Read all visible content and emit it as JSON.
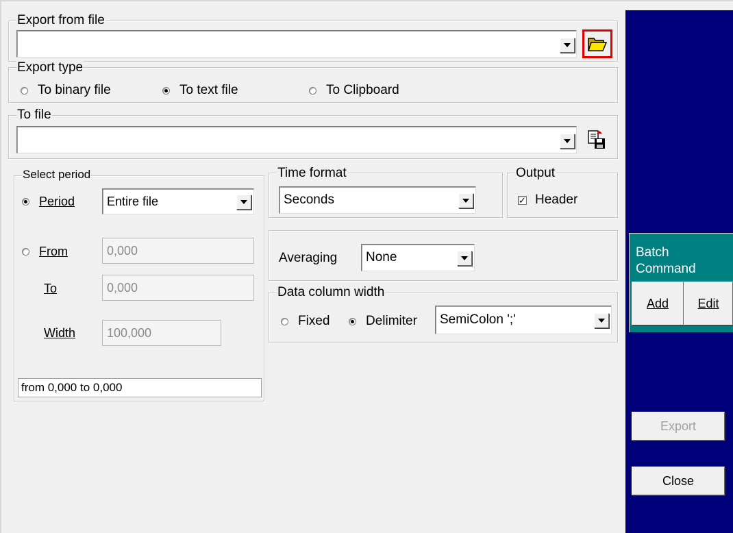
{
  "export_from_file": {
    "legend": "Export from file",
    "value": "",
    "browse_icon": "folder-open-icon"
  },
  "export_type": {
    "legend": "Export type",
    "options": [
      "To binary file",
      "To text file",
      "To Clipboard"
    ],
    "selected": "To text file"
  },
  "to_file": {
    "legend": "To file",
    "value": "",
    "save_icon": "save-file-icon"
  },
  "select_period": {
    "legend": "Select period",
    "period_label": "Period",
    "period_value": "Entire file",
    "from_label": "From",
    "from_value": "0,000",
    "to_label": "To",
    "to_value": "0,000",
    "width_label": "Width",
    "width_value": "100,000",
    "summary": "from 0,000 to 0,000",
    "selected": "Period"
  },
  "time_format": {
    "legend": "Time format",
    "value": "Seconds"
  },
  "output": {
    "legend": "Output",
    "header_label": "Header",
    "header_checked": true
  },
  "averaging": {
    "label": "Averaging",
    "value": "None"
  },
  "data_column_width": {
    "legend": "Data column width",
    "fixed_label": "Fixed",
    "delimiter_label": "Delimiter",
    "selected": "Delimiter",
    "delimiter_value": "SemiColon ';'"
  },
  "batch_command": {
    "title_line1": "Batch",
    "title_line2": "Command",
    "add_label": "Add",
    "edit_label": "Edit"
  },
  "actions": {
    "export_label": "Export",
    "close_label": "Close"
  },
  "colors": {
    "right_pane": "#00007a",
    "batch_panel": "#008080",
    "browse_highlight": "#e00000"
  }
}
